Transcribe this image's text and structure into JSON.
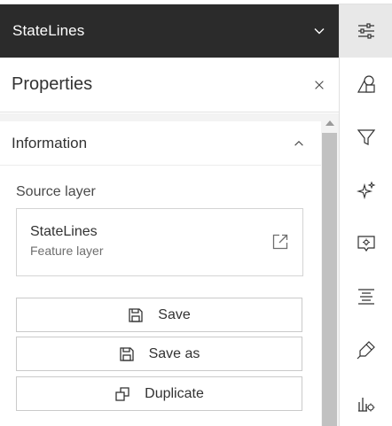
{
  "layer_header": {
    "title": "StateLines"
  },
  "properties": {
    "title": "Properties"
  },
  "information": {
    "title": "Information",
    "source_label": "Source layer",
    "source_name": "StateLines",
    "source_type": "Feature layer"
  },
  "buttons": {
    "save": "Save",
    "save_as": "Save as",
    "duplicate": "Duplicate"
  },
  "toolbar": {
    "items": [
      "properties-sliders-icon",
      "symbology-shapes-icon",
      "filter-icon",
      "effects-sparkle-icon",
      "popups-config-icon",
      "labels-icon",
      "style-brush-icon",
      "charts-config-icon"
    ],
    "active": "properties-sliders-icon"
  }
}
